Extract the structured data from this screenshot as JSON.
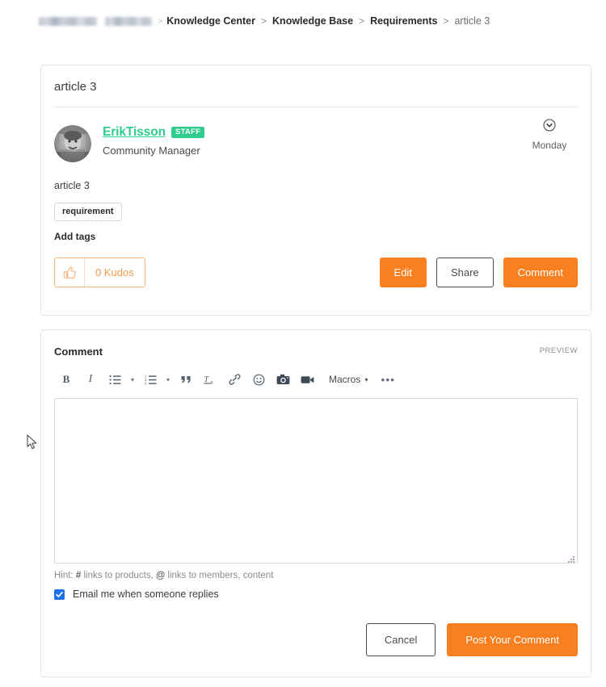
{
  "breadcrumb": {
    "redacted_blocks": 2,
    "separator": ">",
    "items": [
      {
        "label": "Knowledge Center",
        "current": false
      },
      {
        "label": "Knowledge Base",
        "current": false
      },
      {
        "label": "Requirements",
        "current": false
      },
      {
        "label": "article 3",
        "current": true
      }
    ]
  },
  "article": {
    "title": "article 3",
    "author": {
      "name": "ErikTisson",
      "badge": "STAFF",
      "role": "Community Manager",
      "avatar_icon": "user-avatar-photo"
    },
    "date": "Monday",
    "collapse_icon": "chevron-down-circle-icon",
    "body": "article 3",
    "tags": [
      "requirement"
    ],
    "add_tags_label": "Add tags",
    "kudos": {
      "icon": "thumbs-up-icon",
      "label": "0 Kudos"
    },
    "actions": {
      "edit": "Edit",
      "share": "Share",
      "comment": "Comment"
    }
  },
  "comment_editor": {
    "label": "Comment",
    "preview_label": "PREVIEW",
    "toolbar": [
      {
        "name": "bold-icon",
        "glyph": "B"
      },
      {
        "name": "italic-icon",
        "glyph": "I"
      },
      {
        "name": "bulleted-list-icon",
        "glyph": ""
      },
      {
        "name": "bulleted-list-caret-icon",
        "glyph": "▾"
      },
      {
        "name": "numbered-list-icon",
        "glyph": ""
      },
      {
        "name": "numbered-list-caret-icon",
        "glyph": "▾"
      },
      {
        "name": "blockquote-icon",
        "glyph": "”"
      },
      {
        "name": "clear-formatting-icon",
        "glyph": ""
      },
      {
        "name": "link-icon",
        "glyph": ""
      },
      {
        "name": "emoji-icon",
        "glyph": ""
      },
      {
        "name": "camera-icon",
        "glyph": ""
      },
      {
        "name": "video-icon",
        "glyph": ""
      }
    ],
    "macros_label": "Macros",
    "macros_caret": "▾",
    "overflow_label": "•••",
    "textarea_value": "",
    "textarea_placeholder": "",
    "hint": {
      "prefix": "Hint:",
      "hash": "#",
      "hash_text": "links to products,",
      "at": "@",
      "at_text": "links to members, content"
    },
    "notify_checkbox": {
      "label": "Email me when someone replies",
      "checked": true
    },
    "footer": {
      "cancel": "Cancel",
      "post": "Post Your Comment"
    }
  },
  "colors": {
    "accent_orange": "#f98020",
    "author_green": "#2ecc8f",
    "kudos_orange": "#f2994a",
    "checkbox_blue": "#1a73e8",
    "card_border": "#e3e3e3",
    "text": "#3c3c3c"
  }
}
